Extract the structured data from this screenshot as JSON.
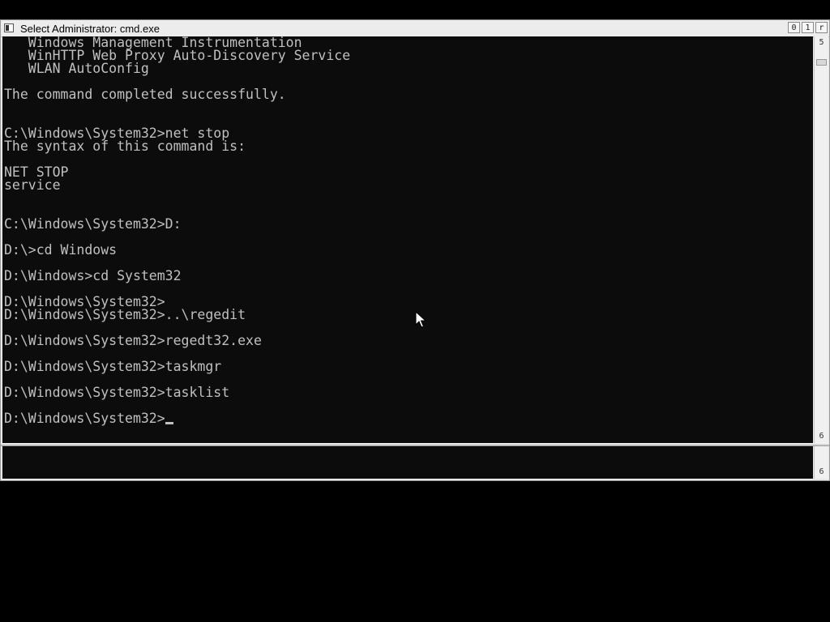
{
  "window": {
    "title": "Select Administrator: cmd.exe",
    "caption_buttons": [
      "0",
      "1",
      "r"
    ]
  },
  "console": {
    "lines": [
      "   Windows Management Instrumentation",
      "   WinHTTP Web Proxy Auto-Discovery Service",
      "   WLAN AutoConfig",
      "",
      "The command completed successfully.",
      "",
      "",
      "C:\\Windows\\System32>net stop",
      "The syntax of this command is:",
      "",
      "NET STOP",
      "service",
      "",
      "",
      "C:\\Windows\\System32>D:",
      "",
      "D:\\>cd Windows",
      "",
      "D:\\Windows>cd System32",
      "",
      "D:\\Windows\\System32>",
      "D:\\Windows\\System32>..\\regedit",
      "",
      "D:\\Windows\\System32>regedt32.exe",
      "",
      "D:\\Windows\\System32>taskmgr",
      "",
      "D:\\Windows\\System32>tasklist",
      "",
      "D:\\Windows\\System32>"
    ]
  },
  "scrollbar": {
    "top_arrow": "5",
    "bottom_arrow": "6"
  },
  "lower_pane": {
    "scrollbar_arrow": "6"
  },
  "icons": {
    "window_icon": "console-window-icon",
    "pointer": "mouse-pointer-icon"
  }
}
